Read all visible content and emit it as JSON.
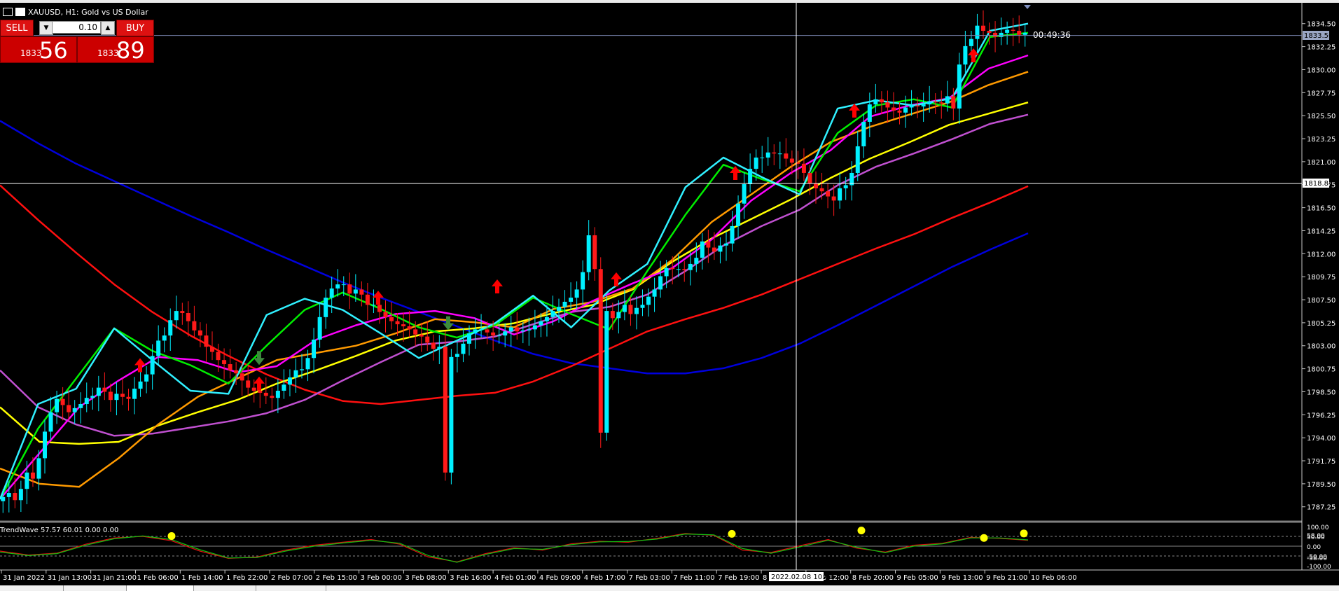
{
  "window": {
    "title": "XAUUSD, H1:  Gold vs US Dollar",
    "countdown": "00:49:36",
    "crosshair_price": "1818.84",
    "current_price_tag": "1833.56",
    "crosshair_time": "2022.02.08 10:00"
  },
  "trade_panel": {
    "sell_label": "SELL",
    "buy_label": "BUY",
    "lot": "0.10",
    "sell_small": "1833",
    "sell_big": "56",
    "buy_small": "1833",
    "buy_big": "89"
  },
  "colors": {
    "bull": "#00f0ff",
    "bear": "#ff1a1a",
    "ma_blue": "#0000dd",
    "ma_red": "#ff1010",
    "ma_violet": "#c050d0",
    "ma_yellow": "#ffff00",
    "ma_orange": "#ff9a00",
    "ma_magenta": "#ff00ff",
    "ma_green": "#00ee00",
    "ma_cyan": "#30f0ff",
    "osc_red": "#e01010",
    "osc_green": "#10c010",
    "osc_dot": "#ffff00"
  },
  "chart_data": {
    "type": "candlestick",
    "symbol": "XAUUSD",
    "timeframe": "H1",
    "ylim": [
      1786.0,
      1836.4
    ],
    "y_ticks": [
      "1834.50",
      "1832.25",
      "1830.00",
      "1827.75",
      "1825.50",
      "1823.25",
      "1821.00",
      "1818.75",
      "1816.50",
      "1814.25",
      "1812.00",
      "1809.75",
      "1807.50",
      "1805.25",
      "1803.00",
      "1800.75",
      "1798.50",
      "1796.25",
      "1794.00",
      "1791.75",
      "1789.50",
      "1787.25"
    ],
    "x_ticks": [
      "31 Jan 2022",
      "31 Jan 13:00",
      "31 Jan 21:00",
      "1 Feb 06:00",
      "1 Feb 14:00",
      "1 Feb 22:00",
      "2 Feb 07:00",
      "2 Feb 15:00",
      "3 Feb 00:00",
      "3 Feb 08:00",
      "3 Feb 16:00",
      "4 Feb 01:00",
      "4 Feb 09:00",
      "4 Feb 17:00",
      "7 Feb 03:00",
      "7 Feb 11:00",
      "7 Feb 19:00",
      "8 Feb 04:00",
      "8 Feb 12:00",
      "8 Feb 20:00",
      "9 Feb 05:00",
      "9 Feb 13:00",
      "9 Feb 21:00",
      "10 Feb 06:00"
    ],
    "close": [
      1788.2,
      1788.6,
      1787.9,
      1789.0,
      1790.6,
      1790.0,
      1792.0,
      1794.6,
      1796.5,
      1797.8,
      1797.2,
      1796.5,
      1796.9,
      1797.3,
      1797.9,
      1798.1,
      1798.9,
      1798.5,
      1797.7,
      1798.3,
      1798.0,
      1797.8,
      1798.8,
      1799.5,
      1800.2,
      1802.0,
      1803.5,
      1804.0,
      1805.5,
      1806.4,
      1806.2,
      1805.4,
      1804.5,
      1804.0,
      1802.9,
      1802.4,
      1801.6,
      1801.2,
      1800.6,
      1800.3,
      1799.6,
      1798.9,
      1798.6,
      1798.4,
      1798.1,
      1797.9,
      1798.6,
      1799.2,
      1799.9,
      1800.6,
      1800.7,
      1801.8,
      1803.6,
      1805.8,
      1807.7,
      1808.6,
      1809.0,
      1809.0,
      1808.1,
      1808.5,
      1808.0,
      1807.0,
      1807.0,
      1806.3,
      1805.8,
      1805.4,
      1805.1,
      1804.9,
      1804.6,
      1804.1,
      1803.9,
      1803.3,
      1802.7,
      1802.9,
      1790.6,
      1801.9,
      1802.2,
      1803.2,
      1804.2,
      1804.6,
      1804.6,
      1804.3,
      1804.0,
      1804.0,
      1804.4,
      1804.8,
      1804.4,
      1804.5,
      1804.6,
      1805.0,
      1805.4,
      1805.8,
      1806.4,
      1806.8,
      1807.3,
      1807.7,
      1808.5,
      1810.2,
      1813.8,
      1810.5,
      1794.5,
      1806.4,
      1805.7,
      1806.3,
      1807.0,
      1806.1,
      1806.7,
      1807.0,
      1807.8,
      1808.5,
      1809.8,
      1810.6,
      1810.5,
      1810.5,
      1810.4,
      1811.0,
      1811.6,
      1813.2,
      1812.6,
      1812.2,
      1812.8,
      1813.0,
      1814.7,
      1816.9,
      1818.8,
      1820.3,
      1821.4,
      1821.4,
      1821.9,
      1821.8,
      1821.8,
      1821.3,
      1820.9,
      1820.8,
      1819.9,
      1818.9,
      1818.4,
      1818.1,
      1817.6,
      1817.2,
      1818.4,
      1818.7,
      1819.9,
      1822.5,
      1824.9,
      1826.6,
      1827.1,
      1826.8,
      1826.3,
      1826.0,
      1825.8,
      1826.3,
      1826.5,
      1826.4,
      1826.6,
      1826.9,
      1826.8,
      1826.7,
      1827.4,
      1826.2,
      1830.5,
      1832.3,
      1833.0,
      1834.3,
      1833.8,
      1833.6,
      1833.2,
      1833.6,
      1833.9,
      1833.8,
      1833.4,
      1833.6
    ],
    "ma_series": [
      {
        "color": "#0000dd",
        "values": [
          1825.0,
          1822.8,
          1820.8,
          1819.1,
          1817.4,
          1815.7,
          1814.1,
          1812.4,
          1810.8,
          1809.2,
          1807.7,
          1806.3,
          1804.9,
          1803.5,
          1802.2,
          1801.3,
          1800.8,
          1800.3,
          1800.3,
          1800.8,
          1801.8,
          1803.2,
          1805.0,
          1806.9,
          1808.8,
          1810.7,
          1812.4,
          1814.0
        ]
      },
      {
        "color": "#ff1010",
        "values": [
          1818.7,
          1815.3,
          1812.1,
          1809.0,
          1806.3,
          1804.0,
          1802.0,
          1800.2,
          1798.7,
          1797.6,
          1797.3,
          1797.7,
          1798.1,
          1798.4,
          1799.5,
          1801.0,
          1802.7,
          1804.4,
          1805.6,
          1806.7,
          1808.0,
          1809.5,
          1811.0,
          1812.5,
          1813.9,
          1815.5,
          1817.0,
          1818.6
        ]
      },
      {
        "color": "#c050d0",
        "values": [
          1800.6,
          1797.0,
          1795.3,
          1794.2,
          1794.4,
          1795.0,
          1795.6,
          1796.4,
          1797.7,
          1799.6,
          1801.4,
          1803.1,
          1803.4,
          1803.9,
          1805.1,
          1806.3,
          1806.8,
          1808.0,
          1810.3,
          1812.8,
          1814.7,
          1816.3,
          1818.7,
          1820.5,
          1821.8,
          1823.2,
          1824.7,
          1825.6
        ]
      },
      {
        "color": "#ffff00",
        "values": [
          1797.0,
          1793.6,
          1793.4,
          1793.6,
          1795.2,
          1796.5,
          1797.7,
          1799.3,
          1800.6,
          1802.0,
          1803.5,
          1804.4,
          1804.7,
          1805.2,
          1806.2,
          1807.0,
          1808.5,
          1811.2,
          1813.5,
          1815.4,
          1817.3,
          1819.4,
          1821.3,
          1822.9,
          1824.6,
          1825.7,
          1826.8
        ]
      },
      {
        "color": "#ff9a00",
        "values": [
          1791.0,
          1789.5,
          1789.2,
          1792.0,
          1795.3,
          1798.0,
          1799.8,
          1801.6,
          1802.3,
          1803.0,
          1804.2,
          1805.6,
          1805.3,
          1804.8,
          1806.6,
          1807.3,
          1808.6,
          1811.4,
          1815.1,
          1817.8,
          1820.5,
          1822.9,
          1824.4,
          1825.6,
          1826.8,
          1828.5,
          1829.8
        ]
      },
      {
        "color": "#ff00ff",
        "values": [
          1788.0,
          1792.5,
          1797.0,
          1799.6,
          1801.9,
          1801.6,
          1800.4,
          1801.0,
          1803.6,
          1805.0,
          1806.1,
          1806.4,
          1805.7,
          1804.1,
          1805.4,
          1807.4,
          1809.1,
          1810.6,
          1813.4,
          1817.2,
          1819.9,
          1822.1,
          1825.4,
          1826.5,
          1827.2,
          1830.1,
          1831.4
        ]
      },
      {
        "color": "#00ee00",
        "values": [
          1788.0,
          1794.9,
          1799.8,
          1804.7,
          1802.5,
          1801.1,
          1799.3,
          1803.0,
          1806.5,
          1808.2,
          1806.6,
          1804.8,
          1803.8,
          1805.0,
          1807.7,
          1806.1,
          1804.6,
          1810.3,
          1815.8,
          1820.7,
          1819.3,
          1818.1,
          1823.8,
          1826.5,
          1827.1,
          1826.3,
          1833.2,
          1833.6
        ]
      },
      {
        "color": "#30f0ff",
        "values": [
          1788.0,
          1797.3,
          1798.8,
          1804.7,
          1801.6,
          1798.6,
          1798.3,
          1806.0,
          1807.6,
          1806.5,
          1804.2,
          1801.8,
          1803.5,
          1805.2,
          1807.9,
          1804.8,
          1808.4,
          1811.0,
          1818.5,
          1821.4,
          1819.5,
          1817.8,
          1826.2,
          1827.0,
          1826.5,
          1827.2,
          1833.8,
          1834.5
        ]
      }
    ],
    "arrows_up": [
      1801.1,
      1799.3,
      1807.7,
      1808.8,
      1809.5,
      1819.9,
      1826.0,
      1831.4
    ],
    "arrows_down": [
      1801.8,
      1805.2
    ],
    "oscillator": {
      "name": "TrendWave 57.57 60.01 0.00 0.00",
      "ylim": [
        -100.0,
        100.0
      ],
      "y_ticks": [
        "100.00",
        "58.00",
        "50.00",
        "0.00",
        "-50.00",
        "-58.00",
        "-100.00"
      ],
      "red": [
        -25,
        -45,
        -35,
        10,
        42,
        50,
        28,
        -25,
        -62,
        -55,
        -20,
        5,
        20,
        34,
        10,
        -55,
        -80,
        -38,
        -8,
        -20,
        12,
        25,
        20,
        40,
        65,
        55,
        -20,
        -32,
        2,
        34,
        -10,
        -30,
        5,
        15,
        45,
        40,
        30
      ],
      "green": [
        -30,
        -48,
        -38,
        5,
        38,
        52,
        34,
        -18,
        -60,
        -58,
        -25,
        0,
        16,
        30,
        15,
        -48,
        -82,
        -42,
        -12,
        -16,
        8,
        22,
        24,
        36,
        62,
        58,
        -12,
        -36,
        -4,
        30,
        -5,
        -33,
        0,
        12,
        42,
        42,
        32
      ],
      "dots": [
        52,
        63,
        80,
        42,
        65,
        48
      ]
    }
  }
}
